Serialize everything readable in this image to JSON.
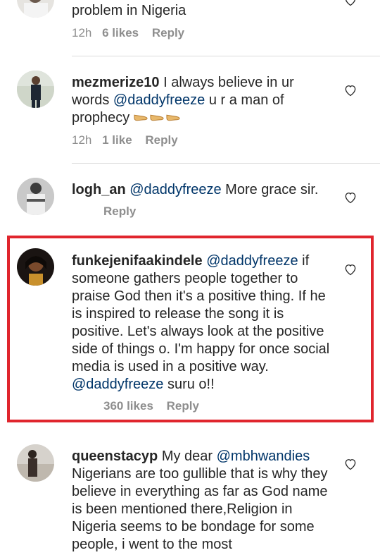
{
  "comments": [
    {
      "text": "problem in Nigeria",
      "time": "12h",
      "likes": "6 likes",
      "reply": "Reply"
    },
    {
      "username": "mezmerize10",
      "text_before": " I always believe in ur words ",
      "mention": "@daddyfreeze",
      "text_after": " u r a man of prophecy ",
      "emoji": "👉👉👉",
      "time": "12h",
      "likes": "1 like",
      "reply": "Reply"
    },
    {
      "username": "logh_an",
      "mention": "@daddyfreeze",
      "text_after": " More grace sir.",
      "reply": "Reply"
    },
    {
      "username": "funkejenifaakindele",
      "mention": "@daddyfreeze",
      "text_after": " if someone gathers people together to praise God then it's a positive thing. If he is inspired to release the song it is positive. Let's always look at the positive side of things o. I'm happy for once social media is used in a positive way. ",
      "mention2": "@daddyfreeze",
      "text_end": " suru o!!",
      "likes": "360 likes",
      "reply": "Reply"
    },
    {
      "username": "queenstacyp",
      "text_before": " My dear ",
      "mention": "@mbhwandies",
      "text_after": " Nigerians are too gullible that is why they believe in everything as far as God name is been mentioned there,Religion in Nigeria seems to be bondage for some people, i went to the most"
    }
  ],
  "colors": {
    "highlight_border": "#e0252d",
    "mention": "#003569",
    "meta": "#8e8e8e"
  },
  "icons": [
    "avatar",
    "heart-outline-icon",
    "pointing-hand-emoji"
  ]
}
